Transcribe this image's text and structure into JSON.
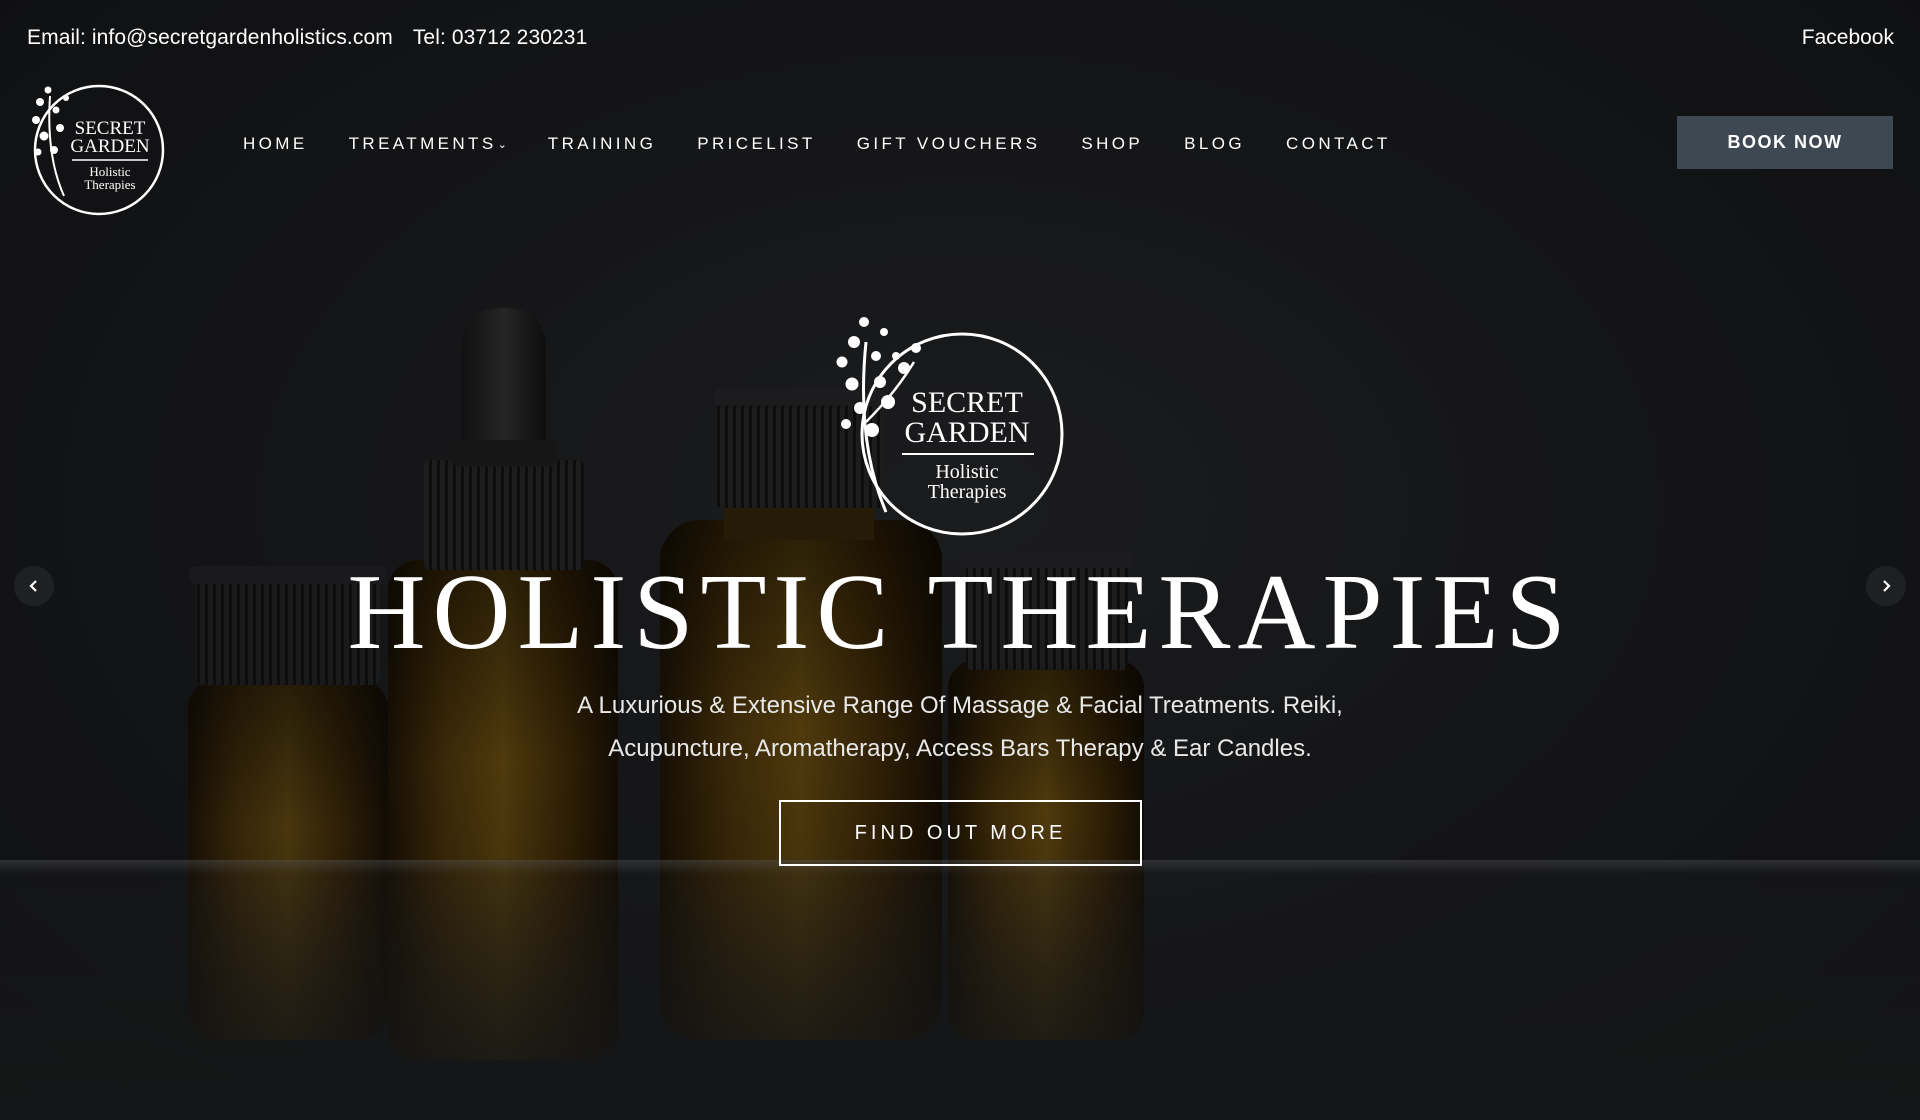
{
  "topbar": {
    "email": "Email: info@secretgardenholistics.com",
    "phone": "Tel: 03712 230231",
    "facebook": "Facebook"
  },
  "logo": {
    "line1": "SECRET",
    "line2": "GARDEN",
    "line3": "Holistic",
    "line4": "Therapies"
  },
  "nav": {
    "items": [
      {
        "label": "HOME"
      },
      {
        "label": "TREATMENTS",
        "caret": "⌄"
      },
      {
        "label": "TRAINING"
      },
      {
        "label": "PRICELIST"
      },
      {
        "label": "GIFT VOUCHERS"
      },
      {
        "label": "SHOP"
      },
      {
        "label": "BLOG"
      },
      {
        "label": "CONTACT"
      }
    ],
    "book_label": "BOOK NOW"
  },
  "hero": {
    "title": "HOLISTIC THERAPIES",
    "subtitle_line1": "A Luxurious & Extensive Range Of Massage & Facial Treatments.  Reiki,",
    "subtitle_line2": "Acupuncture, Aromatherapy,  Access Bars Therapy & Ear Candles.",
    "cta_label": "FIND OUT MORE"
  },
  "slider": {
    "prev_icon": "chevron-left-icon",
    "next_icon": "chevron-right-icon"
  },
  "colors": {
    "background": "#1e1f22",
    "button": "#3d4852",
    "text": "#ffffff",
    "amber": "#8a5a12"
  }
}
